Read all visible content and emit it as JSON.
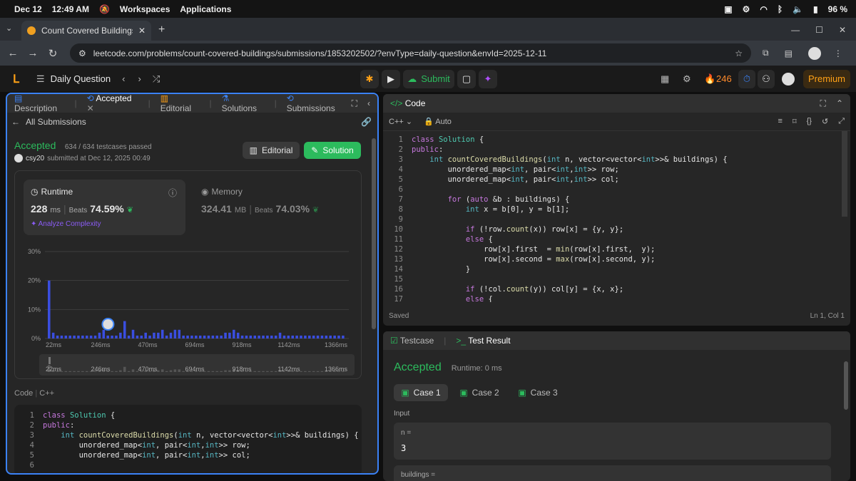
{
  "os": {
    "date": "Dec 12",
    "time": "12:49 AM",
    "workspaces": "Workspaces",
    "applications": "Applications",
    "battery": "96 %"
  },
  "browser": {
    "tab_title": "Count Covered Buildings - Le",
    "url": "leetcode.com/problems/count-covered-buildings/submissions/1853202502/?envType=daily-question&envId=2025-12-11"
  },
  "lc": {
    "daily": "Daily Question",
    "submit": "Submit",
    "streak": "246",
    "premium": "Premium"
  },
  "left": {
    "tabs": [
      "Description",
      "Accepted",
      "Editorial",
      "Solutions",
      "Submissions"
    ],
    "all_submissions": "All Submissions",
    "status": "Accepted",
    "testcases": "634 / 634 testcases passed",
    "user": "csy20",
    "submitted": "submitted at Dec 12, 2025 00:49",
    "editorial_btn": "Editorial",
    "solution_btn": "Solution",
    "runtime_label": "Runtime",
    "runtime_value": "228",
    "runtime_unit": "ms",
    "beats_label": "Beats",
    "runtime_beats": "74.59%",
    "analyze": "Analyze Complexity",
    "memory_label": "Memory",
    "memory_value": "324.41",
    "memory_unit": "MB",
    "memory_beats": "74.03%",
    "code_label": "Code",
    "code_lang": "C++"
  },
  "chart_data": {
    "type": "bar",
    "y_ticks": [
      "30%",
      "20%",
      "10%",
      "0%"
    ],
    "ylim": [
      0,
      30
    ],
    "x_ticks": [
      "22ms",
      "246ms",
      "470ms",
      "694ms",
      "918ms",
      "1142ms",
      "1366ms"
    ],
    "values": [
      20,
      2,
      1,
      1,
      1,
      1,
      1,
      1,
      1,
      1,
      1,
      1,
      2,
      3,
      1,
      1,
      1,
      2,
      6,
      1,
      3,
      1,
      1,
      2,
      1,
      2,
      2,
      3,
      1,
      2,
      3,
      3,
      1,
      1,
      1,
      1,
      1,
      1,
      1,
      1,
      1,
      1,
      2,
      2,
      3,
      2,
      1,
      1,
      1,
      1,
      1,
      1,
      1,
      1,
      1,
      2,
      1,
      1,
      1,
      1,
      1,
      1,
      1,
      1,
      1,
      1,
      1,
      1,
      1,
      1,
      1
    ],
    "user_marker_index": 14
  },
  "editor": {
    "title": "Code",
    "lang": "C++",
    "mode": "Auto",
    "saved": "Saved",
    "cursor": "Ln 1, Col 1"
  },
  "code_lines": [
    "class Solution {",
    "public:",
    "    int countCoveredBuildings(int n, vector<vector<int>>& buildings) {",
    "        unordered_map<int, pair<int,int>> row;",
    "        unordered_map<int, pair<int,int>> col;",
    "",
    "        for (auto &b : buildings) {",
    "            int x = b[0], y = b[1];",
    "",
    "            if (!row.count(x)) row[x] = {y, y};",
    "            else {",
    "                row[x].first  = min(row[x].first,  y);",
    "                row[x].second = max(row[x].second, y);",
    "            }",
    "",
    "            if (!col.count(y)) col[y] = {x, x};",
    "            else {"
  ],
  "result": {
    "tab1": "Testcase",
    "tab2": "Test Result",
    "status": "Accepted",
    "runtime": "Runtime: 0 ms",
    "cases": [
      "Case 1",
      "Case 2",
      "Case 3"
    ],
    "input": "Input",
    "var1": "n =",
    "val1": "3",
    "var2": "buildings ="
  }
}
